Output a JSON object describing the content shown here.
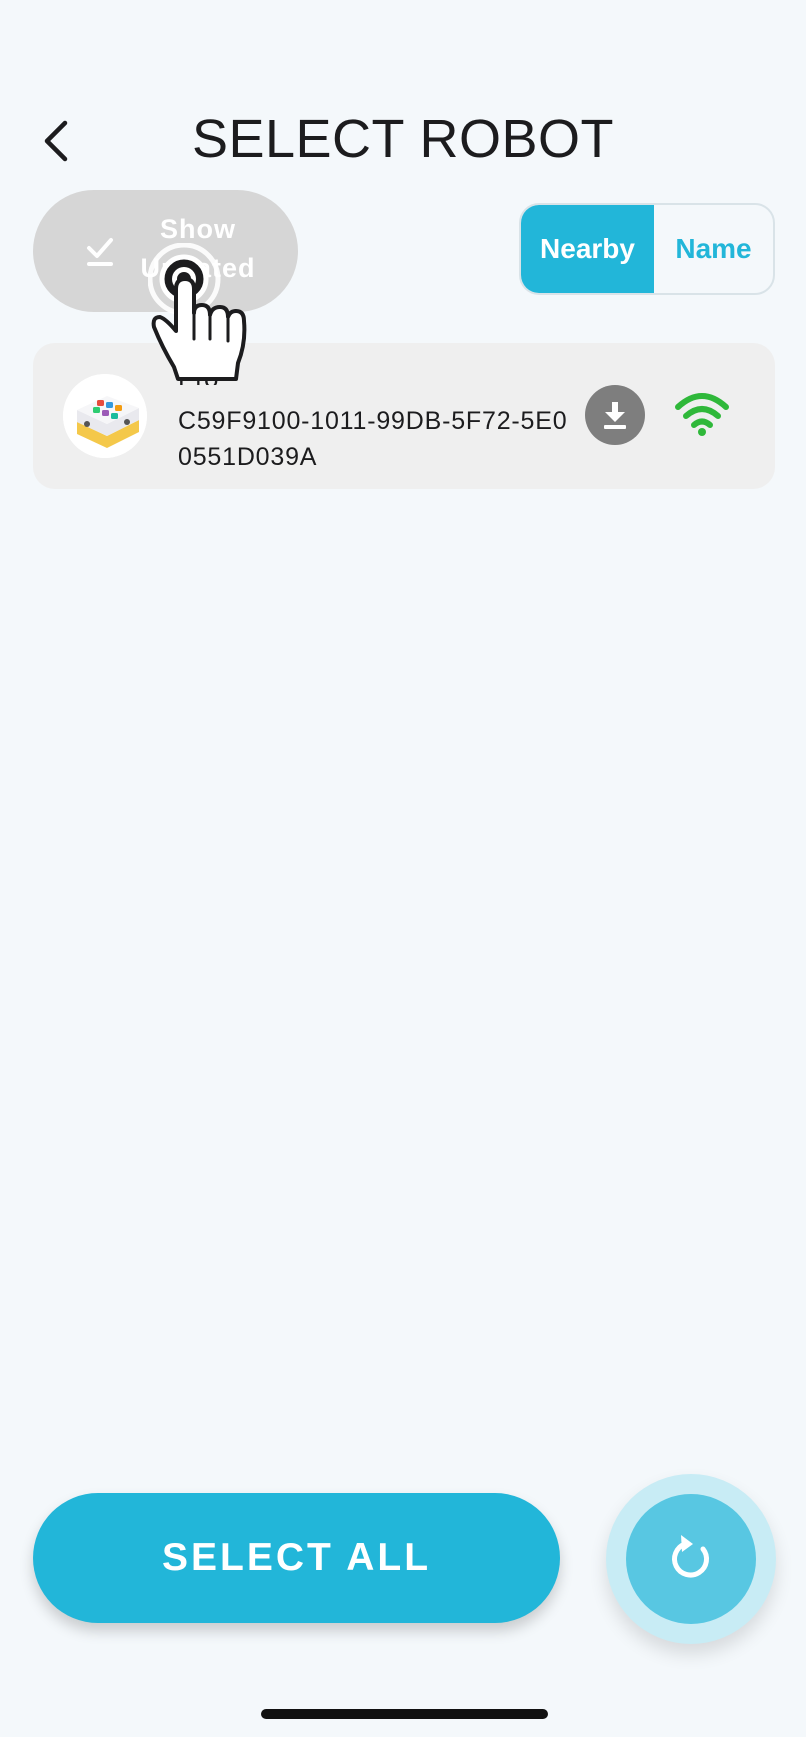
{
  "header": {
    "title": "SELECT ROBOT",
    "back_icon": "chevron-left-icon"
  },
  "filter": {
    "show_updated_label": "Show Updated",
    "icon": "check-icon"
  },
  "sort": {
    "options": [
      "Nearby",
      "Name"
    ],
    "selected": "Nearby"
  },
  "robots": [
    {
      "name": "Pro",
      "id": "C59F9100-1011-99DB-5F72-5E00551D039A",
      "icons": [
        "robot-avatar-icon",
        "download-icon",
        "wifi-icon"
      ],
      "signal_color": "#2fb83a"
    }
  ],
  "actions": {
    "select_all_label": "SELECT ALL",
    "refresh_icon": "refresh-icon"
  },
  "colors": {
    "accent": "#22b6d9",
    "background": "#f4f8fb",
    "toggle_inactive": "#d6d6d6",
    "wifi": "#2fb83a"
  }
}
